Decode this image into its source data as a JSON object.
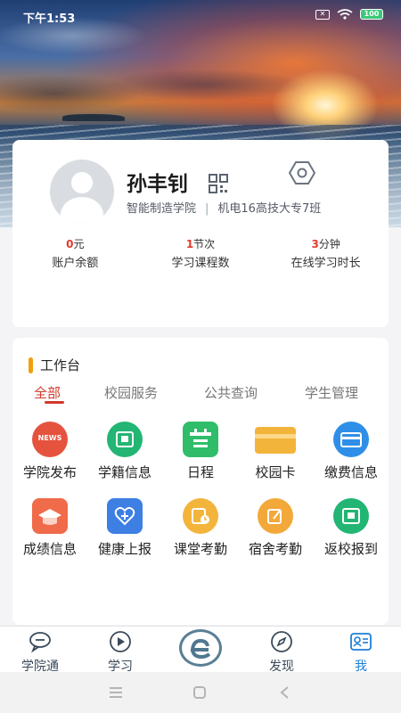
{
  "status_bar": {
    "time": "下午1:53",
    "sim_label": "✕",
    "battery": "100"
  },
  "profile": {
    "name": "孙丰钊",
    "college": "智能制造学院",
    "separator": "|",
    "class": "机电16高技大专7班"
  },
  "stats": [
    {
      "number": "0",
      "unit": "元",
      "label": "账户余额"
    },
    {
      "number": "1",
      "unit": "节次",
      "label": "学习课程数"
    },
    {
      "number": "3",
      "unit": "分钟",
      "label": "在线学习时长"
    }
  ],
  "workbench": {
    "title": "工作台",
    "tabs": [
      "全部",
      "校园服务",
      "公共查询",
      "学生管理"
    ],
    "items": [
      {
        "label": "学院发布",
        "icon": "news-icon",
        "badge": "NEWS",
        "color": "#e5533f"
      },
      {
        "label": "学籍信息",
        "icon": "student-card-icon",
        "color": "#22b573"
      },
      {
        "label": "日程",
        "icon": "calendar-icon",
        "color": "#2fbd6a"
      },
      {
        "label": "校园卡",
        "icon": "campus-card-icon",
        "color": "#f2b43a"
      },
      {
        "label": "缴费信息",
        "icon": "payment-card-icon",
        "color": "#2f8fe8"
      },
      {
        "label": "成绩信息",
        "icon": "graduation-cap-icon",
        "color": "#ef6b4a"
      },
      {
        "label": "健康上报",
        "icon": "health-heart-icon",
        "color": "#3d7fe3"
      },
      {
        "label": "课堂考勤",
        "icon": "attendance-clock-icon",
        "color": "#f3b43c"
      },
      {
        "label": "宿舍考勤",
        "icon": "dorm-edit-icon",
        "color": "#f2a93a"
      },
      {
        "label": "返校报到",
        "icon": "return-school-icon",
        "color": "#22b573"
      }
    ]
  },
  "bottom_nav": {
    "items": [
      {
        "label": "学院通",
        "icon": "chat-bubble-icon"
      },
      {
        "label": "学习",
        "icon": "play-circle-icon"
      },
      {
        "label": "发现",
        "icon": "compass-icon"
      },
      {
        "label": "我",
        "icon": "profile-card-icon"
      }
    ],
    "active": "我",
    "center_logo": "e-logo-icon"
  }
}
